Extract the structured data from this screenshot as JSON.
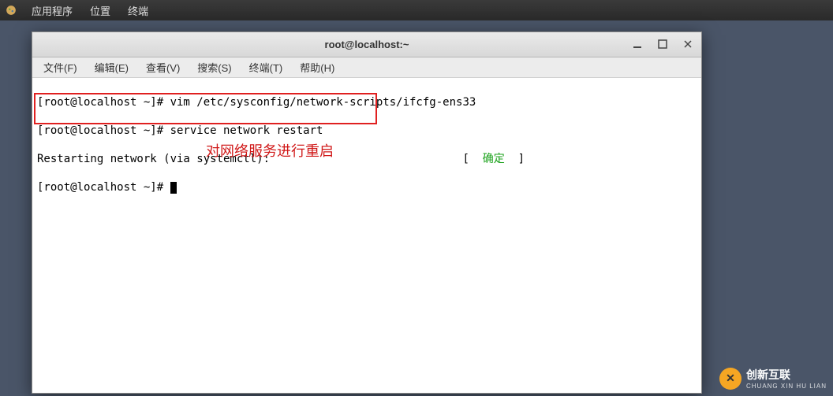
{
  "panel": {
    "apps": "应用程序",
    "places": "位置",
    "terminal": "终端"
  },
  "window": {
    "title": "root@localhost:~"
  },
  "menubar": {
    "file": "文件(F)",
    "edit": "编辑(E)",
    "view": "查看(V)",
    "search": "搜索(S)",
    "terminal": "终端(T)",
    "help": "帮助(H)"
  },
  "terminal": {
    "line1": "[root@localhost ~]# vim /etc/sysconfig/network-scripts/ifcfg-ens33",
    "line2": "[root@localhost ~]# service network restart",
    "line3_left": "Restarting network (via systemctl):",
    "line3_bracket_l": "[",
    "line3_status": "  确定  ",
    "line3_bracket_r": "]",
    "line4": "[root@localhost ~]# "
  },
  "annotation": "对网络服务进行重启",
  "watermark": {
    "main": "创新互联",
    "sub": "CHUANG XIN HU LIAN",
    "icon": "✕"
  }
}
